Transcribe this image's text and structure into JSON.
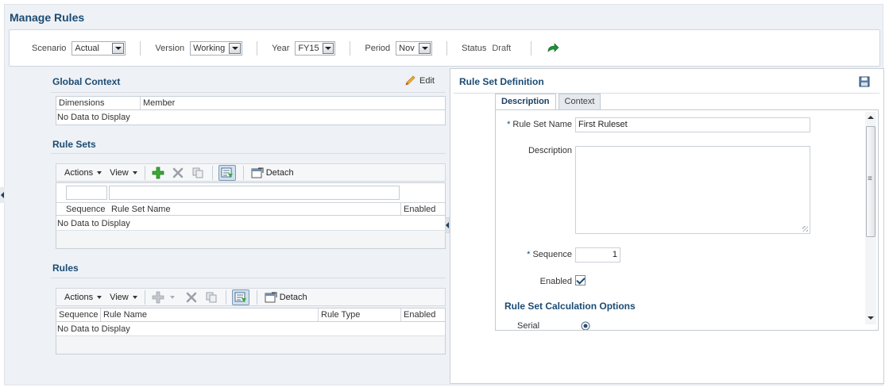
{
  "page": {
    "title": "Manage Rules"
  },
  "toolbar": {
    "scenario": {
      "label": "Scenario",
      "value": "Actual"
    },
    "version": {
      "label": "Version",
      "value": "Working"
    },
    "year": {
      "label": "Year",
      "value": "FY15"
    },
    "period": {
      "label": "Period",
      "value": "Nov"
    },
    "status": {
      "label": "Status",
      "value": "Draft"
    },
    "refresh_icon": "refresh-icon"
  },
  "global_context": {
    "title": "Global Context",
    "edit_label": "Edit",
    "columns": [
      "Dimensions",
      "Member"
    ],
    "empty_text": "No Data to Display"
  },
  "rule_sets": {
    "title": "Rule Sets",
    "actions_label": "Actions",
    "view_label": "View",
    "detach_label": "Detach",
    "columns": [
      "Sequence",
      "Rule Set Name",
      "Enabled"
    ],
    "empty_text": "No Data to Display"
  },
  "rules": {
    "title": "Rules",
    "actions_label": "Actions",
    "view_label": "View",
    "detach_label": "Detach",
    "columns": [
      "Sequence",
      "Rule Name",
      "Rule Type",
      "Enabled"
    ],
    "empty_text": "No Data to Display"
  },
  "rule_set_definition": {
    "title": "Rule Set Definition",
    "tabs": [
      "Description",
      "Context"
    ],
    "active_tab": "Description",
    "fields": {
      "rule_set_name": {
        "label": "Rule Set Name",
        "value": "First Ruleset",
        "required": "*"
      },
      "description": {
        "label": "Description",
        "value": ""
      },
      "sequence": {
        "label": "Sequence",
        "value": "1",
        "required": "*"
      },
      "enabled": {
        "label": "Enabled",
        "checked": true
      }
    },
    "calc_options_title": "Rule Set Calculation Options",
    "serial_execution_label": "Serial Execution"
  },
  "colors": {
    "title_blue": "#1b4b73",
    "background": "#eef1f5",
    "border": "#c9d0d7"
  }
}
